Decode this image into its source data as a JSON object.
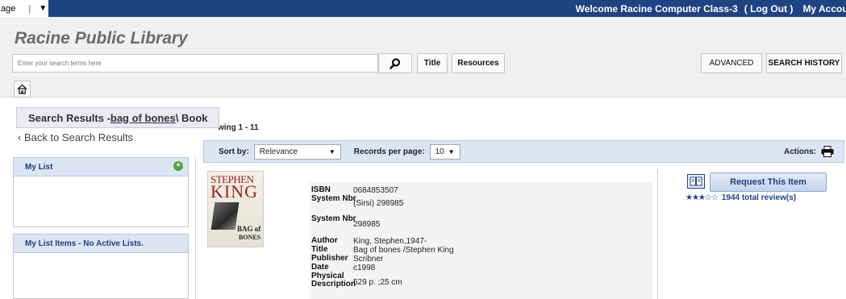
{
  "topbar": {
    "language_partial": "age",
    "separator": "|",
    "dropdown_arrow": "▼",
    "welcome": "Welcome Racine Computer Class-3",
    "logout": "( Log Out )",
    "my_account": "My Account"
  },
  "header": {
    "library_name": "Racine Public Library",
    "search_placeholder": "Enter your search terms here",
    "title_button": "Title",
    "resources_button": "Resources",
    "advanced_button": "ADVANCED",
    "history_button": "SEARCH HISTORY"
  },
  "breadcrumb": {
    "prefix": "Search Results - ",
    "query": "bag of bones",
    "suffix": " \\ Book"
  },
  "showing": "wing 1 - 11",
  "back_link": "‹ Back to Search Results",
  "sidebar": {
    "my_list": "My List",
    "my_list_items": "My List Items - No Active Lists."
  },
  "sortbar": {
    "sort_label": "Sort by:",
    "sort_value": "Relevance",
    "records_label": "Records per page:",
    "records_value": "10",
    "actions_label": "Actions:"
  },
  "cover": {
    "author_line1": "STEPHEN",
    "author_line2": "KING",
    "title_line1": "BAG of",
    "title_line2": "BONES"
  },
  "record": {
    "fields": [
      {
        "label": "ISBN",
        "value": "0684853507"
      },
      {
        "label": "System Nbr",
        "value": "(Sirsi) 298985"
      },
      {
        "label": "System Nbr",
        "value": "298985"
      },
      {
        "label": "Author",
        "value": "King, Stephen,1947-"
      },
      {
        "label": "Title",
        "value": "Bag of bones /Stephen King"
      },
      {
        "label": "Publisher",
        "value": "Scribner"
      },
      {
        "label": "Date",
        "value": "c1998"
      },
      {
        "label": "Physical Description",
        "value": "529 p. ;25 cm"
      }
    ]
  },
  "actions_panel": {
    "request_button": "Request This Item",
    "stars": "★★★☆☆",
    "rating_value": 3,
    "rating_max": 5,
    "reviews": "1944 total review(s)"
  },
  "colors": {
    "topbar_blue": "#1e4382",
    "panel_blue": "#dce5f4",
    "header_gray": "#f0f0f0"
  }
}
